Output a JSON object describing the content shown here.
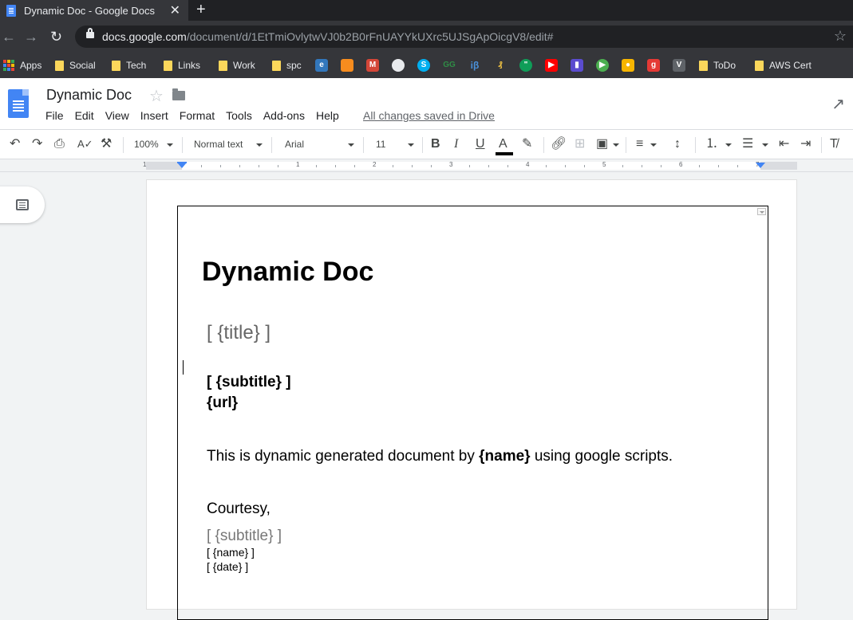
{
  "browser": {
    "tab_title": "Dynamic Doc - Google Docs",
    "tab_close": "✕",
    "new_tab": "+",
    "url_host": "docs.google.com",
    "url_path": "/document/d/1EtTmiOvlytwVJ0b2B0rFnUAYYkUXrc5UJSgApOicgV8/edit#"
  },
  "bookmarks": {
    "apps": "Apps",
    "folders": [
      "Social",
      "Tech",
      "Links",
      "Work",
      "spc",
      "ToDo",
      "AWS Cert"
    ],
    "site_icons": [
      {
        "name": "edge-icon",
        "color": "#3277bc"
      },
      {
        "name": "box-icon",
        "color": "#f78c1e"
      },
      {
        "name": "gmail-icon",
        "color": "#d44638"
      },
      {
        "name": "github-icon",
        "color": "#e8eaed"
      },
      {
        "name": "skype-icon",
        "color": "#00aff0"
      },
      {
        "name": "geeks-icon",
        "color": "#2f8d46"
      },
      {
        "name": "ib-icon",
        "color": "#4a90d9"
      },
      {
        "name": "coin-icon",
        "color": "#f4c542"
      },
      {
        "name": "hangouts-icon",
        "color": "#0f9d58"
      },
      {
        "name": "youtube-icon",
        "color": "#ff0000"
      },
      {
        "name": "stats-icon",
        "color": "#5b4ccf"
      },
      {
        "name": "play-icon",
        "color": "#4caf50"
      },
      {
        "name": "keep-icon",
        "color": "#f7b500"
      },
      {
        "name": "g-icon",
        "color": "#e53935"
      },
      {
        "name": "vs-icon",
        "color": "#5f6368"
      }
    ]
  },
  "docs": {
    "title": "Dynamic Doc",
    "menu": [
      "File",
      "Edit",
      "View",
      "Insert",
      "Format",
      "Tools",
      "Add-ons",
      "Help"
    ],
    "save_status": "All changes saved in Drive"
  },
  "toolbar": {
    "zoom": "100%",
    "style": "Normal text",
    "font": "Arial",
    "size": "11"
  },
  "ruler": {
    "numbers": [
      "1",
      "1",
      "2",
      "3",
      "4",
      "5",
      "6",
      "7"
    ]
  },
  "document": {
    "heading": "Dynamic Doc",
    "title_field": "[ {title} ]",
    "subtitle": "[ {subtitle} ]",
    "url": "{url}",
    "body_before": "This is dynamic generated document by ",
    "body_name": "{name}",
    "body_after": " using google scripts.",
    "courtesy": "Courtesy,",
    "sig_subtitle": "[ {subtitle} ]",
    "sig_name": "[ {name} ]",
    "sig_date": "[ {date} ]"
  }
}
